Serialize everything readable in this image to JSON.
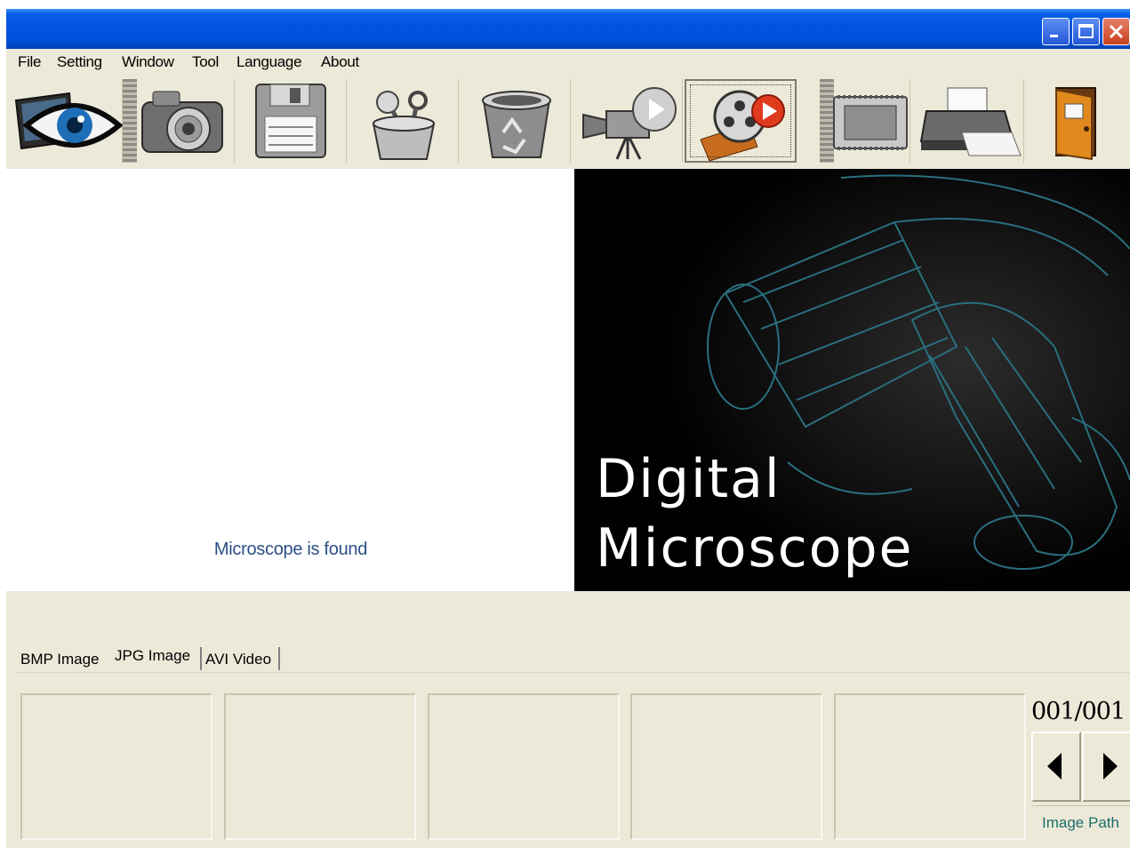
{
  "window": {
    "controls": [
      "minimize-icon",
      "maximize-icon",
      "close-icon"
    ]
  },
  "menu": {
    "items": [
      "File",
      "Setting",
      "Window",
      "Tool",
      "Language",
      "About"
    ]
  },
  "toolbar": {
    "icons": [
      "preview-eye-icon",
      "camera-icon",
      "floppy-disk-icon",
      "tools-cup-icon",
      "recycle-bin-icon",
      "video-camera-icon",
      "film-reel-icon",
      "memory-chip-icon",
      "printer-icon",
      "exit-door-icon"
    ],
    "active_index": 6
  },
  "preview": {
    "status": "Microscope is found"
  },
  "splash": {
    "title": "Digital\nMicroscope"
  },
  "tabs": [
    "BMP Image",
    "JPG Image",
    "AVI Video"
  ],
  "selected_tab": "JPG Image",
  "thumbnails": {
    "count": 5
  },
  "pager": {
    "count": "001/001",
    "prev_icon": "triangle-left-icon",
    "next_icon": "triangle-right-icon",
    "path_label": "Image Path"
  },
  "colors": {
    "titlebar": "#0054e3",
    "window_bg": "#ece9d8",
    "status_text": "#2a4f86",
    "path_text": "#1c6e6a"
  }
}
